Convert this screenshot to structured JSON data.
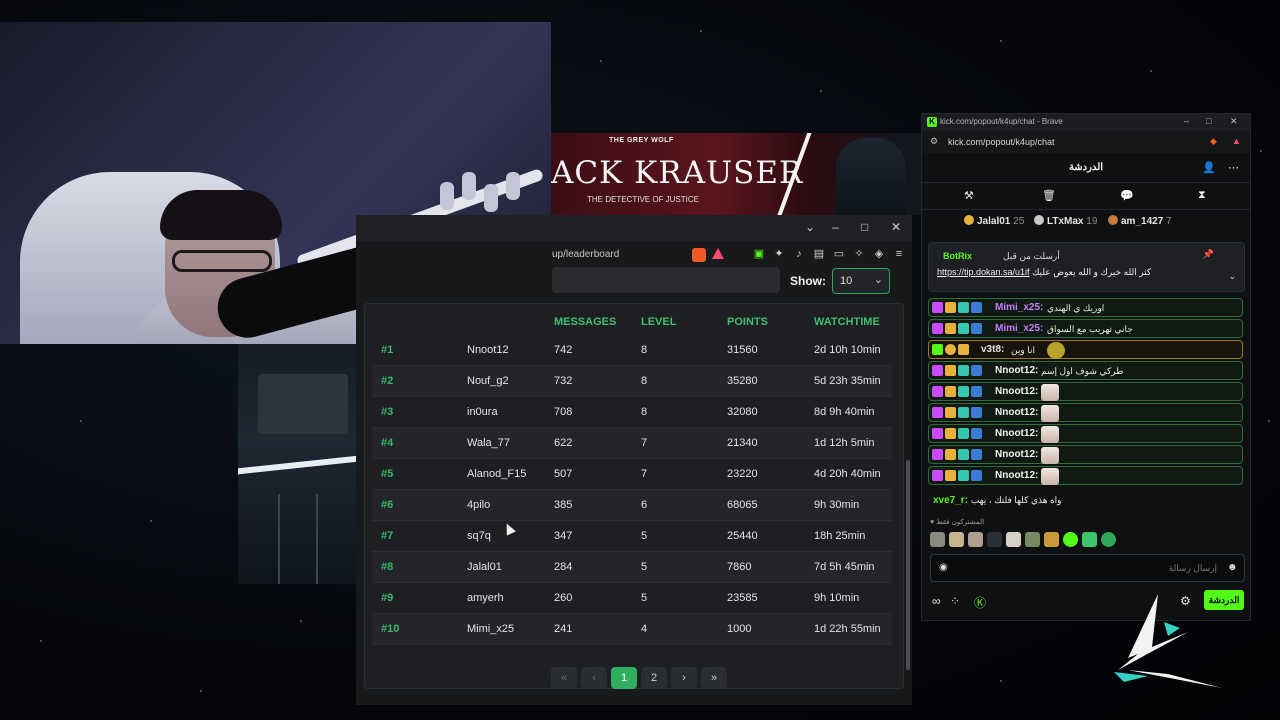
{
  "banner": {
    "subtitle": "THE GREY WOLF",
    "title": "ACK KRAUSER",
    "tagline": "THE DETECTIVE OF JUSTICE"
  },
  "leaderboard_window": {
    "url": "up/leaderboard",
    "show_label": "Show:",
    "show_value": "10",
    "columns": [
      "MESSAGES",
      "LEVEL",
      "POINTS",
      "WATCHTIME"
    ],
    "rows": [
      {
        "rank": "#1",
        "user": "Nnoot12",
        "messages": "742",
        "level": "8",
        "points": "31560",
        "watchtime": "2d 10h 10min"
      },
      {
        "rank": "#2",
        "user": "Nouf_g2",
        "messages": "732",
        "level": "8",
        "points": "35280",
        "watchtime": "5d 23h 35min"
      },
      {
        "rank": "#3",
        "user": "in0ura",
        "messages": "708",
        "level": "8",
        "points": "32080",
        "watchtime": "8d 9h 40min"
      },
      {
        "rank": "#4",
        "user": "Wala_77",
        "messages": "622",
        "level": "7",
        "points": "21340",
        "watchtime": "1d 12h 5min"
      },
      {
        "rank": "#5",
        "user": "Alanod_F15",
        "messages": "507",
        "level": "7",
        "points": "23220",
        "watchtime": "4d 20h 40min"
      },
      {
        "rank": "#6",
        "user": "4pilo",
        "messages": "385",
        "level": "6",
        "points": "68065",
        "watchtime": "9h 30min"
      },
      {
        "rank": "#7",
        "user": "sq7q",
        "messages": "347",
        "level": "5",
        "points": "25440",
        "watchtime": "18h 25min"
      },
      {
        "rank": "#8",
        "user": "Jalal01",
        "messages": "284",
        "level": "5",
        "points": "7860",
        "watchtime": "7d 5h 45min"
      },
      {
        "rank": "#9",
        "user": "amyerh",
        "messages": "260",
        "level": "5",
        "points": "23585",
        "watchtime": "9h 10min"
      },
      {
        "rank": "#10",
        "user": "Mimi_x25",
        "messages": "241",
        "level": "4",
        "points": "1000",
        "watchtime": "1d 22h 55min"
      }
    ],
    "pager": {
      "first": "«",
      "prev": "‹",
      "page1": "1",
      "page2": "2",
      "next": "›",
      "last": "»"
    }
  },
  "chat": {
    "window_title": "kick.com/popout/k4up/chat - Brave",
    "url": "kick.com/popout/k4up/chat",
    "header": "الدردشة",
    "leaders": [
      {
        "name": "Jalal01",
        "count": "25",
        "color": "#e8b23a"
      },
      {
        "name": "LTxMax",
        "count": "19",
        "color": "#c8c8c8"
      },
      {
        "name": "am_1427",
        "count": "7",
        "color": "#c77b3a"
      }
    ],
    "pinned": {
      "sender_label": "أرسلت من قبل",
      "bot": "BotRix",
      "text": "كثر الله خيرك و الله يعوض عليك",
      "link": "https://tip.dokan.sa/u1if"
    },
    "messages": [
      {
        "user": "Mimi_x25:",
        "text": "اوريك ي الهندي",
        "color": "#c87dff"
      },
      {
        "user": "Mimi_x25:",
        "text": "جاني تهريب مع السواق",
        "color": "#c87dff"
      },
      {
        "user": "v3t8:",
        "text": "انا وين",
        "color": "#e4e4e4"
      },
      {
        "user": "Nnoot12:",
        "text": "طركي شوف اول إسم",
        "color": "#f2f2f2"
      },
      {
        "user": "Nnoot12:",
        "text": "",
        "color": "#f2f2f2"
      },
      {
        "user": "Nnoot12:",
        "text": "",
        "color": "#f2f2f2"
      },
      {
        "user": "Nnoot12:",
        "text": "",
        "color": "#f2f2f2"
      },
      {
        "user": "Nnoot12:",
        "text": "",
        "color": "#f2f2f2"
      },
      {
        "user": "Nnoot12:",
        "text": "",
        "color": "#f2f2f2"
      }
    ],
    "plain_message": {
      "user": "xve7_r:",
      "text": "واه هذي كلها فلتك ، يهب"
    },
    "subs_label": "المشتركون فقط",
    "input_placeholder": "إرسال رسالة",
    "send_label": "الدردشة"
  }
}
